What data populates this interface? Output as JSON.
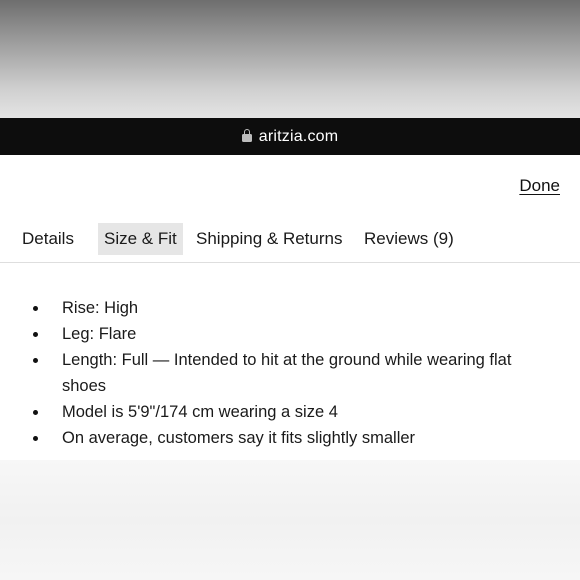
{
  "browser": {
    "url": "aritzia.com",
    "lock_icon": "lock-icon"
  },
  "panel": {
    "done_label": "Done",
    "tabs": [
      {
        "label": "Details",
        "active": false
      },
      {
        "label": "Size & Fit",
        "active": true
      },
      {
        "label": "Shipping & Returns",
        "active": false
      },
      {
        "label": "Reviews (9)",
        "active": false
      }
    ],
    "bullets": [
      "Rise: High",
      "Leg: Flare",
      "Length: Full — Intended to hit at the ground while wearing flat shoes",
      "Model is 5'9\"/174 cm wearing a size 4",
      "On average, customers say it fits slightly smaller"
    ]
  },
  "colors": {
    "url_bar_bg": "#0d0d0d",
    "active_tab_bg": "#e6e6e6"
  }
}
